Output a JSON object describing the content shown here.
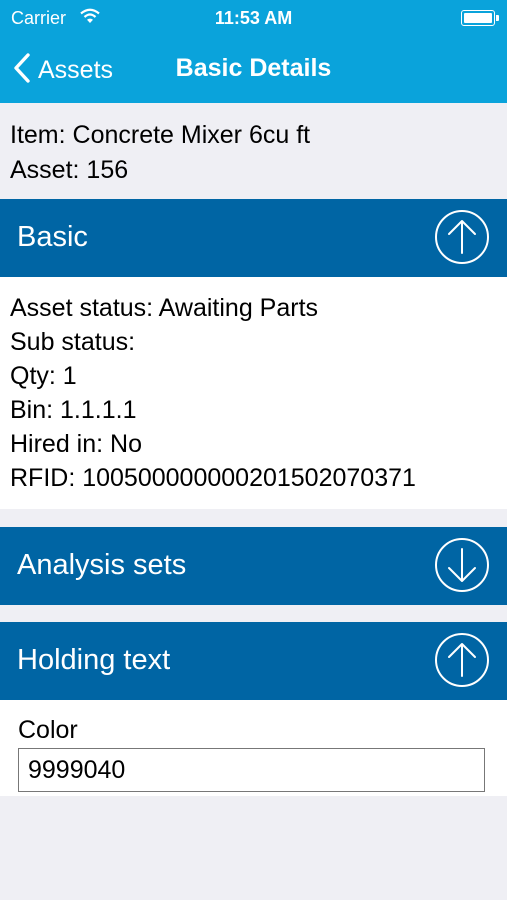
{
  "status_bar": {
    "carrier": "Carrier",
    "time": "11:53 AM"
  },
  "nav": {
    "back_label": "Assets",
    "title": "Basic Details"
  },
  "item": {
    "item_line": "Item: Concrete Mixer 6cu ft",
    "asset_line": "Asset: 156"
  },
  "sections": {
    "basic": {
      "title": "Basic",
      "toggle_icon": "arrow-up-circle-icon",
      "lines": [
        "Asset status: Awaiting Parts",
        "Sub status:",
        "Qty: 1",
        "Bin: 1.1.1.1",
        "Hired in: No",
        "RFID: 100500000000201502070371"
      ]
    },
    "analysis": {
      "title": "Analysis sets",
      "toggle_icon": "arrow-down-circle-icon"
    },
    "holding": {
      "title": "Holding text",
      "toggle_icon": "arrow-up-circle-icon",
      "color_label": "Color",
      "color_value": "9999040"
    }
  },
  "colors": {
    "nav_bar": "#0aa3db",
    "section_header": "#0065a4",
    "background": "#efeff4"
  }
}
